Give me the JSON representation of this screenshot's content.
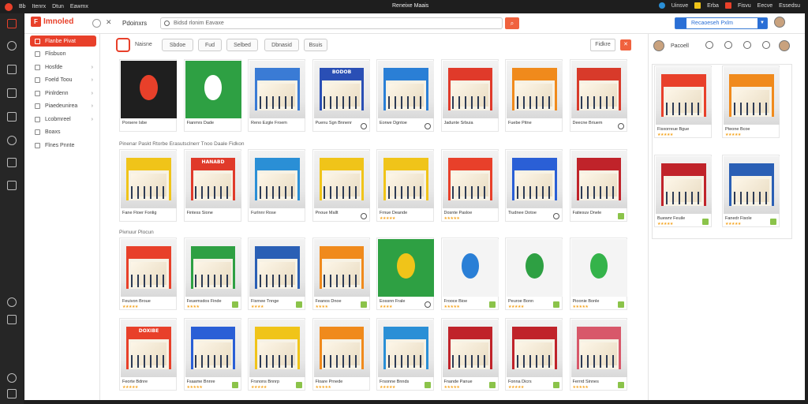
{
  "topbar": {
    "items": [
      "Bb",
      "Itenrx",
      "Dtun",
      "Eawmx"
    ],
    "center": "Reneixe Maais",
    "right": [
      "Uinsve",
      "Erba",
      "Fisvu",
      "Eecve",
      "Essedsu"
    ]
  },
  "header": {
    "brand": "Imnoled",
    "tab_title": "Pdoinxrs",
    "search_placeholder": "Bidsd rlonim Eavaxe",
    "right_field": "Recaoeseh Pxlm"
  },
  "sidebar": {
    "items": [
      {
        "label": "Flanbe Pivat",
        "chevron": false
      },
      {
        "label": "Flisbuon",
        "chevron": false
      },
      {
        "label": "Hosfde",
        "chevron": true
      },
      {
        "label": "Foeld Toou",
        "chevron": true
      },
      {
        "label": "Pinlrdenn",
        "chevron": true
      },
      {
        "label": "Piaedeunirea",
        "chevron": true
      },
      {
        "label": "Lcobmreel",
        "chevron": true
      },
      {
        "label": "Boaxs",
        "chevron": false
      },
      {
        "label": "Flnes Pnnte",
        "chevron": false
      }
    ]
  },
  "toolbar": {
    "home_label": "Naisne",
    "buttons": [
      "Sbdoe",
      "Fud",
      "Selbed",
      "Dbnasid",
      "Bsuis"
    ],
    "right_button": "Fidkre"
  },
  "sections": {
    "row2_label": "Pinenar Paskt Rtorbe Erasutsclnerr Tnoo Daale Fidkon",
    "row3_label": "Pivnuur Plocun"
  },
  "cards": [
    {
      "title": "Porsere Isbe",
      "kind": "logo",
      "accent": "#e8402a",
      "bg": "#1f1f1f",
      "stars": "",
      "icon": ""
    },
    {
      "title": "Fianmrs Dade",
      "kind": "logo",
      "accent": "#ffffff",
      "bg": "#2ea043",
      "stars": "",
      "icon": ""
    },
    {
      "title": "Reno Ezgle Froem",
      "kind": "store",
      "accent": "#3a7bd5",
      "bg": "",
      "sign": "",
      "stars": "",
      "icon": ""
    },
    {
      "title": "Puenu Sgn Bnnenr",
      "kind": "store",
      "accent": "#2a4fb5",
      "bg": "",
      "sign": "BODOB",
      "stars": "",
      "icon": "dark"
    },
    {
      "title": "Eorwe Dgntoe",
      "kind": "store",
      "accent": "#2a7fd6",
      "bg": "",
      "sign": "",
      "stars": "",
      "icon": "dark"
    },
    {
      "title": "Jadunte Srbuia",
      "kind": "store",
      "accent": "#e03a2a",
      "bg": "",
      "sign": "",
      "stars": "",
      "icon": ""
    },
    {
      "title": "Fuebe Pitne",
      "kind": "store",
      "accent": "#f08a1c",
      "bg": "",
      "sign": "",
      "stars": "",
      "icon": ""
    },
    {
      "title": "Deecne Briuem",
      "kind": "store",
      "accent": "#d83a2a",
      "bg": "",
      "sign": "",
      "stars": "",
      "icon": "dark"
    },
    {
      "title": "Fane Ftoer Fonlig",
      "kind": "store",
      "accent": "#f0c419",
      "bg": "",
      "sign": "",
      "stars": "",
      "icon": ""
    },
    {
      "title": "Fintess Sione",
      "kind": "store",
      "accent": "#e03a2a",
      "bg": "",
      "sign": "HANABD",
      "stars": "",
      "icon": ""
    },
    {
      "title": "Furlnnr Rose",
      "kind": "store",
      "accent": "#2a8fd6",
      "bg": "",
      "sign": "",
      "stars": "",
      "icon": ""
    },
    {
      "title": "Pnoue Mallt",
      "kind": "store",
      "accent": "#f0c419",
      "bg": "",
      "sign": "",
      "stars": "",
      "icon": "dark"
    },
    {
      "title": "Frnue Deande",
      "kind": "store",
      "accent": "#f0c419",
      "bg": "",
      "sign": "",
      "stars": "★★★★★",
      "icon": ""
    },
    {
      "title": "Dosnte Pasloe",
      "kind": "store",
      "accent": "#e8402a",
      "bg": "",
      "sign": "",
      "stars": "★★★★★",
      "icon": ""
    },
    {
      "title": "Tiudnee Dotoe",
      "kind": "store",
      "accent": "#2a5fd6",
      "bg": "",
      "sign": "",
      "stars": "",
      "icon": "dark"
    },
    {
      "title": "Fatiesuv Dnele",
      "kind": "store",
      "accent": "#c0232a",
      "bg": "",
      "sign": "",
      "stars": "",
      "icon": "green"
    },
    {
      "title": "Feuivon Broue",
      "kind": "store",
      "accent": "#e8402a",
      "bg": "",
      "sign": "",
      "stars": "★★★★★",
      "icon": ""
    },
    {
      "title": "Feuemsdos Finde",
      "kind": "store",
      "accent": "#2ea043",
      "bg": "",
      "sign": "",
      "stars": "★★★★",
      "icon": "green"
    },
    {
      "title": "Fisrnee Tnnge",
      "kind": "store",
      "accent": "#2a5fb5",
      "bg": "",
      "sign": "",
      "stars": "★★★★",
      "icon": "green"
    },
    {
      "title": "Feanos Dnoe",
      "kind": "store",
      "accent": "#f08a1c",
      "bg": "",
      "sign": "",
      "stars": "★★★★",
      "icon": "green"
    },
    {
      "title": "Eossnn Frale",
      "kind": "logo",
      "accent": "#f0c419",
      "bg": "#2ea043",
      "stars": "★★★★",
      "icon": "dark"
    },
    {
      "title": "Frooce Bioe",
      "kind": "logo",
      "accent": "#2a7fd6",
      "bg": "#f4f4f4",
      "stars": "★★★★★",
      "icon": "green"
    },
    {
      "title": "Peuroe Bonn",
      "kind": "logo",
      "accent": "#2ea043",
      "bg": "#f4f4f4",
      "stars": "★★★★★",
      "icon": "green"
    },
    {
      "title": "Pioonie Bonle",
      "kind": "logo",
      "accent": "#34b34a",
      "bg": "#f4f4f4",
      "stars": "★★★★★",
      "icon": "green"
    },
    {
      "title": "Feorte Bdnre",
      "kind": "store",
      "accent": "#e8402a",
      "bg": "",
      "sign": "DOXIBE",
      "stars": "★★★★★",
      "icon": ""
    },
    {
      "title": "Fsaame Bnnre",
      "kind": "store",
      "accent": "#2a5fd6",
      "bg": "",
      "sign": "",
      "stars": "★★★★★",
      "icon": "green"
    },
    {
      "title": "Frsnons Bnnrp",
      "kind": "store",
      "accent": "#f0c419",
      "bg": "",
      "sign": "",
      "stars": "★★★★★",
      "icon": "green"
    },
    {
      "title": "Floare Prnede",
      "kind": "store",
      "accent": "#f08a1c",
      "bg": "",
      "sign": "",
      "stars": "★★★★★",
      "icon": ""
    },
    {
      "title": "Frsonne Bnnds",
      "kind": "store",
      "accent": "#2a8fd6",
      "bg": "",
      "sign": "",
      "stars": "★★★★★",
      "icon": "green"
    },
    {
      "title": "Fnande Panue",
      "kind": "store",
      "accent": "#c0232a",
      "bg": "",
      "sign": "",
      "stars": "★★★★★",
      "icon": "green"
    },
    {
      "title": "Fonna Dicrs",
      "kind": "store",
      "accent": "#c0232a",
      "bg": "",
      "sign": "",
      "stars": "★★★★★",
      "icon": "green"
    },
    {
      "title": "Ferrrd Sinnes",
      "kind": "store",
      "accent": "#d8586a",
      "bg": "",
      "sign": "",
      "stars": "★★★★★",
      "icon": "green"
    }
  ],
  "right_panel": {
    "label": "Pacoell",
    "cards": [
      {
        "title": "Fisxorreue Bgue",
        "kind": "store",
        "accent": "#e8402a",
        "stars": "★★★★★",
        "icon": ""
      },
      {
        "title": "Pteone Bcoe",
        "kind": "store",
        "accent": "#f08a1c",
        "stars": "★★★★★",
        "icon": ""
      },
      {
        "title": "Buewnr Feuile",
        "kind": "store",
        "accent": "#c0232a",
        "stars": "★★★★★",
        "icon": "green"
      },
      {
        "title": "Fanedr Fisole",
        "kind": "store",
        "accent": "#2a5fb5",
        "stars": "★★★★★",
        "icon": "green"
      }
    ]
  }
}
